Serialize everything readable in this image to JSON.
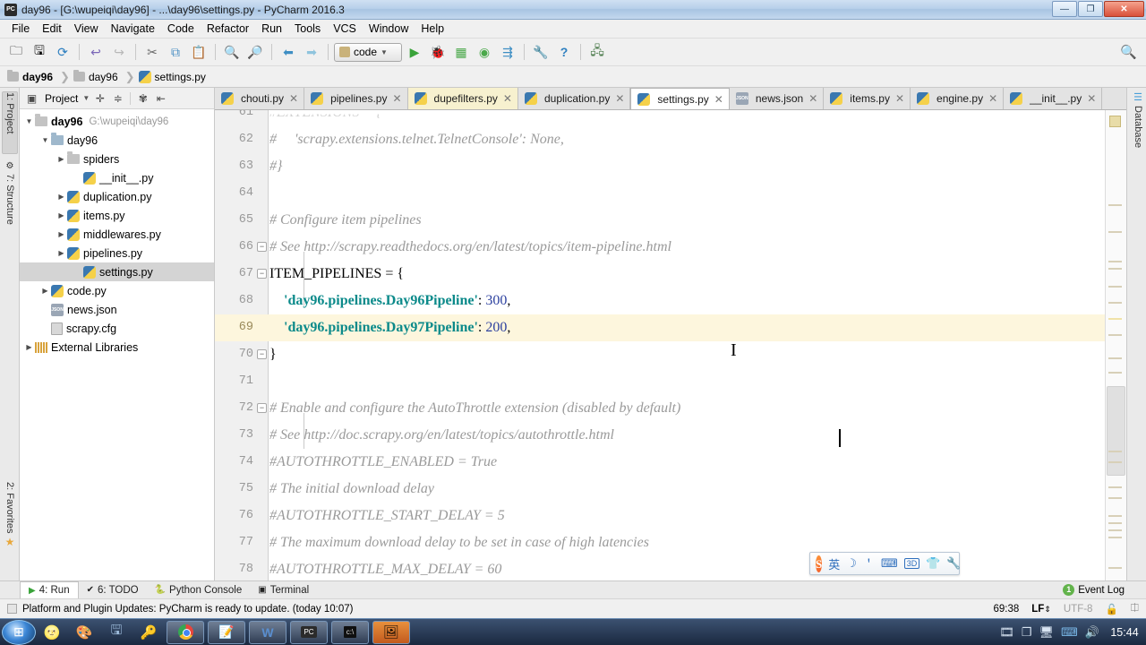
{
  "window": {
    "title": "day96 - [G:\\wupeiqi\\day96] - ...\\day96\\settings.py - PyCharm 2016.3",
    "app_icon": "PC",
    "minimize_label": "—",
    "maximize_label": "❐",
    "close_label": "✕"
  },
  "menubar": {
    "items": [
      "File",
      "Edit",
      "View",
      "Navigate",
      "Code",
      "Refactor",
      "Run",
      "Tools",
      "VCS",
      "Window",
      "Help"
    ]
  },
  "toolbar": {
    "run_config_label": "code",
    "icons": [
      "open-folder-icon",
      "save-all-icon",
      "sync-icon",
      "undo-icon",
      "redo-icon",
      "cut-icon",
      "copy-icon",
      "paste-icon",
      "find-icon",
      "replace-icon",
      "back-icon",
      "forward-icon"
    ],
    "run_icons": [
      "run-icon",
      "debug-icon",
      "coverage-icon",
      "profile-icon",
      "run-with-console-icon",
      "settings-icon",
      "help-icon",
      "updates-icon"
    ],
    "search_icon": "search-icon"
  },
  "breadcrumb": {
    "items": [
      {
        "label": "day96",
        "icon": "folder-icon",
        "bold": true
      },
      {
        "label": "day96",
        "icon": "folder-icon",
        "bold": false
      },
      {
        "label": "settings.py",
        "icon": "python-file-icon",
        "bold": false
      }
    ]
  },
  "left_strip": {
    "tabs": [
      {
        "label": "1: Project",
        "selected": true
      },
      {
        "label": "7: Structure",
        "selected": false
      },
      {
        "label": "2: Favorites",
        "selected": false
      }
    ]
  },
  "right_strip": {
    "tabs": [
      {
        "label": "Database",
        "selected": false
      }
    ]
  },
  "project_panel": {
    "title": "Project",
    "header_icons": [
      "collapse-all-icon",
      "expand-all-icon",
      "gear-icon",
      "hide-icon"
    ],
    "tree": [
      {
        "label": "day96",
        "path": "G:\\wupeiqi\\day96",
        "icon": "folder-icon",
        "indent": 0,
        "arrow": "▼",
        "bold": true,
        "selected": false
      },
      {
        "label": "day96",
        "path": "",
        "icon": "module-folder-icon",
        "indent": 1,
        "arrow": "▼",
        "bold": false,
        "selected": false
      },
      {
        "label": "spiders",
        "path": "",
        "icon": "folder-icon",
        "indent": 2,
        "arrow": "▶",
        "bold": false,
        "selected": false
      },
      {
        "label": "__init__.py",
        "path": "",
        "icon": "python-file-icon",
        "indent": 3,
        "arrow": "",
        "bold": false,
        "selected": false
      },
      {
        "label": "duplication.py",
        "path": "",
        "icon": "python-file-icon",
        "indent": 2,
        "arrow": "▶",
        "bold": false,
        "selected": false
      },
      {
        "label": "items.py",
        "path": "",
        "icon": "python-file-icon",
        "indent": 2,
        "arrow": "▶",
        "bold": false,
        "selected": false
      },
      {
        "label": "middlewares.py",
        "path": "",
        "icon": "python-file-icon",
        "indent": 2,
        "arrow": "▶",
        "bold": false,
        "selected": false
      },
      {
        "label": "pipelines.py",
        "path": "",
        "icon": "python-file-icon",
        "indent": 2,
        "arrow": "▶",
        "bold": false,
        "selected": false
      },
      {
        "label": "settings.py",
        "path": "",
        "icon": "python-file-icon",
        "indent": 3,
        "arrow": "",
        "bold": false,
        "selected": true
      },
      {
        "label": "code.py",
        "path": "",
        "icon": "python-file-icon",
        "indent": 1,
        "arrow": "▶",
        "bold": false,
        "selected": false
      },
      {
        "label": "news.json",
        "path": "",
        "icon": "json-file-icon",
        "indent": 1,
        "arrow": "",
        "bold": false,
        "selected": false
      },
      {
        "label": "scrapy.cfg",
        "path": "",
        "icon": "config-file-icon",
        "indent": 1,
        "arrow": "",
        "bold": false,
        "selected": false
      },
      {
        "label": "External Libraries",
        "path": "",
        "icon": "library-icon",
        "indent": 0,
        "arrow": "▶",
        "bold": false,
        "selected": false
      }
    ]
  },
  "editor_tabs": [
    {
      "label": "chouti.py",
      "icon": "python-file-icon",
      "active": false,
      "highlight": false
    },
    {
      "label": "pipelines.py",
      "icon": "python-file-icon",
      "active": false,
      "highlight": false
    },
    {
      "label": "dupefilters.py",
      "icon": "python-file-icon",
      "active": false,
      "highlight": true
    },
    {
      "label": "duplication.py",
      "icon": "python-file-icon",
      "active": false,
      "highlight": false
    },
    {
      "label": "settings.py",
      "icon": "python-file-icon",
      "active": true,
      "highlight": false
    },
    {
      "label": "news.json",
      "icon": "json-file-icon",
      "active": false,
      "highlight": false
    },
    {
      "label": "items.py",
      "icon": "python-file-icon",
      "active": false,
      "highlight": false
    },
    {
      "label": "engine.py",
      "icon": "python-file-icon",
      "active": false,
      "highlight": false
    },
    {
      "label": "__init__.py",
      "icon": "python-file-icon",
      "active": false,
      "highlight": false
    }
  ],
  "editor": {
    "current_line": 69,
    "first_visible_line": 61,
    "lines": [
      {
        "n": 61,
        "tokens": [
          {
            "t": "#EXTENSIONS = {",
            "c": "cm"
          }
        ],
        "fold": "",
        "clipped": true
      },
      {
        "n": 62,
        "tokens": [
          {
            "t": "#     'scrapy.extensions.telnet.TelnetConsole': None,",
            "c": "cm"
          }
        ],
        "fold": ""
      },
      {
        "n": 63,
        "tokens": [
          {
            "t": "#}",
            "c": "cm"
          }
        ],
        "fold": ""
      },
      {
        "n": 64,
        "tokens": [],
        "fold": ""
      },
      {
        "n": 65,
        "tokens": [
          {
            "t": "# Configure item pipelines",
            "c": "cm"
          }
        ],
        "fold": ""
      },
      {
        "n": 66,
        "tokens": [
          {
            "t": "# See http://scrapy.readthedocs.org/en/latest/topics/item-pipeline.html",
            "c": "cm"
          }
        ],
        "fold": "minus"
      },
      {
        "n": 67,
        "tokens": [
          {
            "t": "ITEM_PIPELINES = {",
            "c": "kwn"
          }
        ],
        "fold": "minus"
      },
      {
        "n": 68,
        "tokens": [
          {
            "t": "    ",
            "c": "pun"
          },
          {
            "t": "'day96.pipelines.Day96Pipeline'",
            "c": "str"
          },
          {
            "t": ": ",
            "c": "pun"
          },
          {
            "t": "300",
            "c": "num"
          },
          {
            "t": ",",
            "c": "pun"
          }
        ],
        "fold": ""
      },
      {
        "n": 69,
        "tokens": [
          {
            "t": "    ",
            "c": "pun"
          },
          {
            "t": "'day96.pipelines.Day97Pipeline'",
            "c": "str"
          },
          {
            "t": ": ",
            "c": "pun"
          },
          {
            "t": "200",
            "c": "num"
          },
          {
            "t": ",",
            "c": "pun"
          }
        ],
        "fold": ""
      },
      {
        "n": 70,
        "tokens": [
          {
            "t": "}",
            "c": "kwn"
          }
        ],
        "fold": "minus"
      },
      {
        "n": 71,
        "tokens": [],
        "fold": ""
      },
      {
        "n": 72,
        "tokens": [
          {
            "t": "# Enable and configure the AutoThrottle extension (disabled by default)",
            "c": "cm"
          }
        ],
        "fold": "minus"
      },
      {
        "n": 73,
        "tokens": [
          {
            "t": "# See http://doc.scrapy.org/en/latest/topics/autothrottle.html",
            "c": "cm"
          }
        ],
        "fold": ""
      },
      {
        "n": 74,
        "tokens": [
          {
            "t": "#AUTOTHROTTLE_ENABLED = True",
            "c": "cm"
          }
        ],
        "fold": ""
      },
      {
        "n": 75,
        "tokens": [
          {
            "t": "# The initial download delay",
            "c": "cm"
          }
        ],
        "fold": ""
      },
      {
        "n": 76,
        "tokens": [
          {
            "t": "#AUTOTHROTTLE_START_DELAY = 5",
            "c": "cm"
          }
        ],
        "fold": ""
      },
      {
        "n": 77,
        "tokens": [
          {
            "t": "# The maximum download delay to be set in case of high latencies",
            "c": "cm"
          }
        ],
        "fold": ""
      },
      {
        "n": 78,
        "tokens": [
          {
            "t": "#AUTOTHROTTLE_MAX_DELAY = 60",
            "c": "cm"
          }
        ],
        "fold": ""
      }
    ]
  },
  "bottom_bar": {
    "tabs": [
      {
        "label": "4: Run",
        "icon": "run-icon",
        "selected": true
      },
      {
        "label": "6: TODO",
        "icon": "todo-icon",
        "selected": false
      },
      {
        "label": "Python Console",
        "icon": "python-icon",
        "selected": false
      },
      {
        "label": "Terminal",
        "icon": "terminal-icon",
        "selected": false
      }
    ],
    "event_log": {
      "label": "Event Log",
      "count": "1"
    }
  },
  "status_bar": {
    "message": "Platform and Plugin Updates: PyCharm is ready to update. (today 10:07)",
    "caret_position": "69:38",
    "line_separator": "LF",
    "encoding": "UTF-8",
    "lock_icon": "lock-icon",
    "branch_icon": "vcs-branch-icon"
  },
  "ime_bar": {
    "logo": "S",
    "items": [
      "英",
      "☽",
      "＇",
      "⌨",
      "3D",
      "👕",
      "🔧"
    ]
  },
  "taskbar": {
    "start_label": "⊞",
    "quick_launch": [
      "media-player-icon",
      "paint-icon",
      "save-icon",
      "key-icon"
    ],
    "buttons": [
      "chrome-icon",
      "editor-icon",
      "word-icon",
      "pycharm-icon",
      "cmd-icon",
      "app-icon"
    ],
    "tray": [
      "media-icon",
      "windows-icon",
      "network-icon",
      "ime-icon",
      "volume-icon"
    ],
    "clock": "15:44"
  },
  "colors": {
    "accent": "#3a6ea5",
    "string": "#0b8a8a",
    "number": "#2b3f9e",
    "comment": "#9a9a9a",
    "current_line": "#fdf6dd"
  }
}
